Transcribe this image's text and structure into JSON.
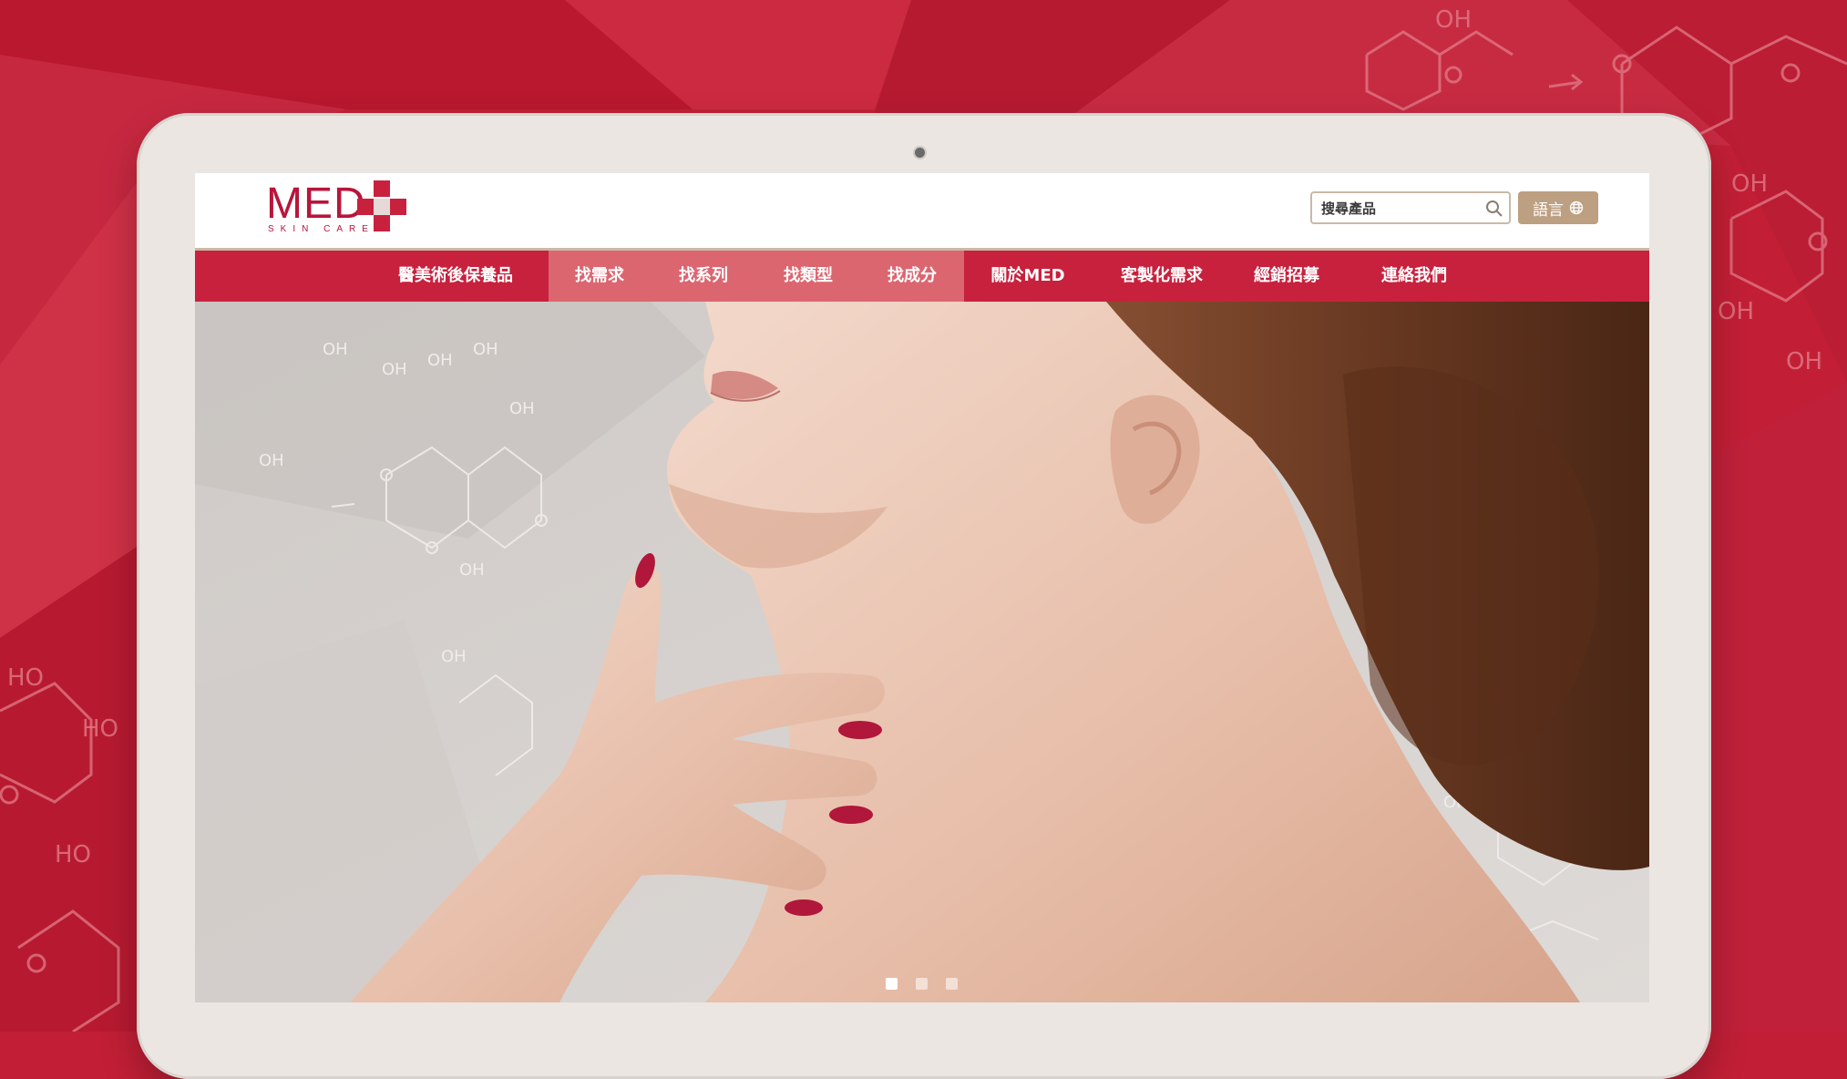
{
  "brand": {
    "logo_text": "MED",
    "logo_sub": "SKIN CARE",
    "color": "#b8153a"
  },
  "search": {
    "placeholder": "搜尋產品",
    "icon": "search-icon"
  },
  "language_button": {
    "label": "語言",
    "icon": "globe-icon"
  },
  "nav": {
    "items": [
      {
        "label": "醫美術後保養品"
      },
      {
        "label": "找需求"
      },
      {
        "label": "找系列"
      },
      {
        "label": "找類型"
      },
      {
        "label": "找成分"
      },
      {
        "label": "關於MED"
      },
      {
        "label": "客製化需求"
      },
      {
        "label": "經銷招募"
      },
      {
        "label": "連絡我們"
      }
    ]
  },
  "hero": {
    "slides_total": 3,
    "active_slide": 1
  },
  "colors": {
    "background": "#c21f36",
    "nav": "#c8213d",
    "nav_highlight": "#dc6670",
    "accent_gold": "#bd9f82"
  }
}
